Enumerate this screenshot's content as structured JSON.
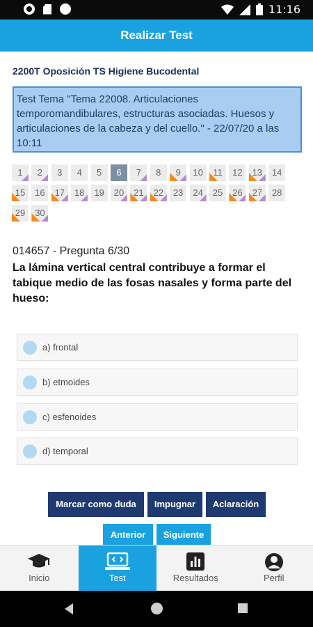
{
  "statusbar": {
    "time": "11:16"
  },
  "appbar": {
    "title": "Realizar Test"
  },
  "test": {
    "name": "2200T Oposición TS Higiene Bucodental",
    "description": "Test Tema \"Tema 22008. Articulaciones temporomandibulares, estructuras asociadas. Huesos y articulaciones de la cabeza y del cuello.\" - 22/07/20 a las 10:11"
  },
  "question_grid": {
    "current": 6,
    "cells": [
      {
        "n": "1",
        "orange": false,
        "purple": true
      },
      {
        "n": "2",
        "orange": false,
        "purple": true
      },
      {
        "n": "3",
        "orange": false,
        "purple": false
      },
      {
        "n": "4",
        "orange": false,
        "purple": false
      },
      {
        "n": "5",
        "orange": false,
        "purple": false
      },
      {
        "n": "6",
        "orange": false,
        "purple": false
      },
      {
        "n": "7",
        "orange": false,
        "purple": true
      },
      {
        "n": "8",
        "orange": false,
        "purple": false
      },
      {
        "n": "9",
        "orange": true,
        "purple": true
      },
      {
        "n": "10",
        "orange": false,
        "purple": false
      },
      {
        "n": "11",
        "orange": true,
        "purple": false
      },
      {
        "n": "12",
        "orange": false,
        "purple": false
      },
      {
        "n": "13",
        "orange": true,
        "purple": true
      },
      {
        "n": "14",
        "orange": false,
        "purple": false
      },
      {
        "n": "15",
        "orange": true,
        "purple": false
      },
      {
        "n": "16",
        "orange": false,
        "purple": false
      },
      {
        "n": "17",
        "orange": true,
        "purple": true
      },
      {
        "n": "18",
        "orange": false,
        "purple": true
      },
      {
        "n": "19",
        "orange": false,
        "purple": false
      },
      {
        "n": "20",
        "orange": false,
        "purple": true
      },
      {
        "n": "21",
        "orange": true,
        "purple": true
      },
      {
        "n": "22",
        "orange": true,
        "purple": true
      },
      {
        "n": "23",
        "orange": false,
        "purple": false
      },
      {
        "n": "24",
        "orange": false,
        "purple": true
      },
      {
        "n": "25",
        "orange": false,
        "purple": false
      },
      {
        "n": "26",
        "orange": true,
        "purple": true
      },
      {
        "n": "27",
        "orange": true,
        "purple": true
      },
      {
        "n": "28",
        "orange": false,
        "purple": false
      },
      {
        "n": "29",
        "orange": true,
        "purple": false
      },
      {
        "n": "30",
        "orange": true,
        "purple": true
      }
    ]
  },
  "question": {
    "id_label": "014657 - Pregunta 6/30",
    "text": "La lámina vertical central contribuye a formar el tabique medio de las fosas nasales y forma parte del hueso:"
  },
  "options": [
    {
      "label": "a) frontal"
    },
    {
      "label": "b) etmoides"
    },
    {
      "label": "c) esfenoides"
    },
    {
      "label": "d) temporal"
    }
  ],
  "actions": {
    "mark_doubt": "Marcar como duda",
    "challenge": "Impugnar",
    "clarification": "Aclaración",
    "previous": "Anterior",
    "next": "Siguiente"
  },
  "bottom_nav": {
    "items": [
      {
        "label": "Inicio",
        "icon": "graduation-cap-icon"
      },
      {
        "label": "Test",
        "icon": "laptop-code-icon",
        "active": true
      },
      {
        "label": "Resultados",
        "icon": "bar-chart-icon"
      },
      {
        "label": "Perfil",
        "icon": "user-icon"
      }
    ]
  },
  "colors": {
    "primary": "#1aa2e0",
    "dark_button": "#1f3a70",
    "orange_mark": "#f58a1f",
    "purple_mark": "#b48ccf"
  }
}
